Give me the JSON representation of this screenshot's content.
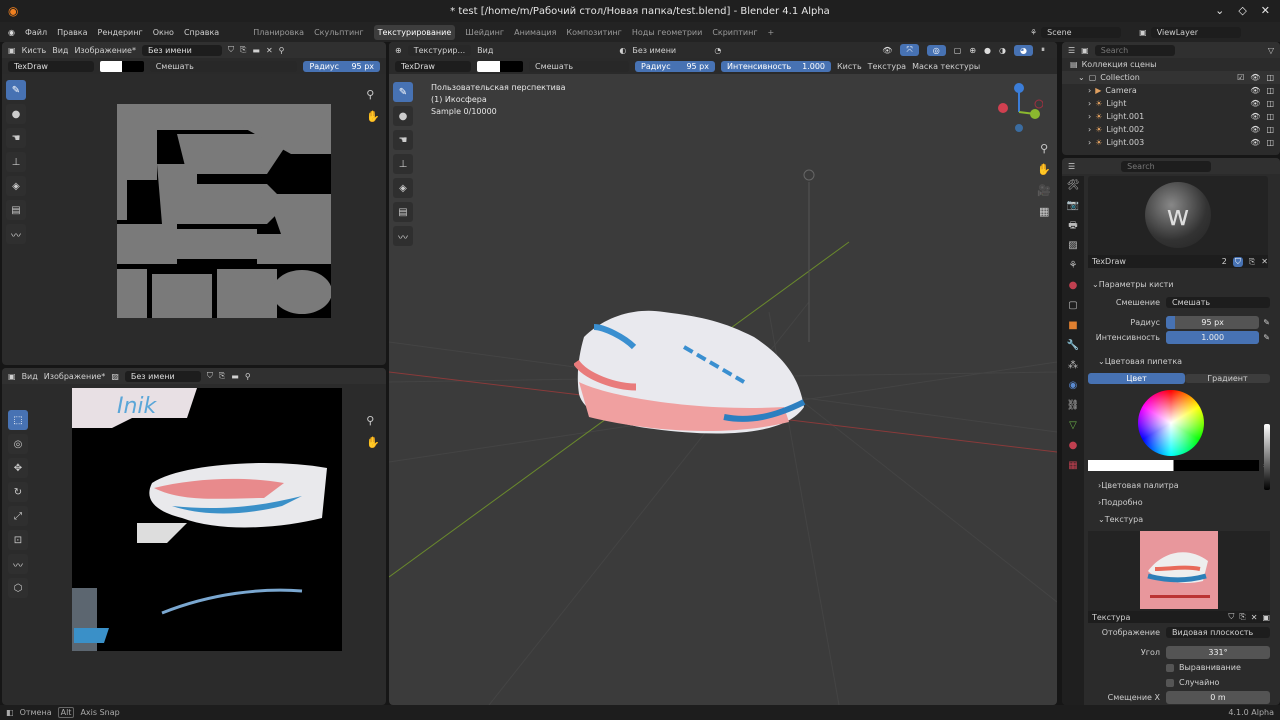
{
  "window": {
    "title": "* test [/home/m/Рабочий стол/Новая папка/test.blend] - Blender 4.1 Alpha"
  },
  "menu": [
    "Файл",
    "Правка",
    "Рендеринг",
    "Окно",
    "Справка"
  ],
  "workspaces": [
    "Планировка",
    "Скульптинг",
    "Текстурирование",
    "Шейдинг",
    "Анимация",
    "Композитинг",
    "Ноды геометрии",
    "Скриптинг"
  ],
  "active_workspace": "Текстурирование",
  "scene": "Scene",
  "view_layer": "ViewLayer",
  "image_editor_top": {
    "mode": "Кисть",
    "view": "Вид",
    "image_menu": "Изображение*",
    "image_name": "Без имени",
    "brush": "TexDraw",
    "blend": "Смешать",
    "radius_label": "Радиус",
    "radius": "95 px"
  },
  "image_editor_bottom": {
    "view": "Вид",
    "image_menu": "Изображение*",
    "image_name": "Без имени"
  },
  "viewport": {
    "mode": "Текстурир...",
    "view": "Вид",
    "image_name": "Без имени",
    "brush": "TexDraw",
    "blend": "Смешать",
    "radius_label": "Радиус",
    "radius": "95 px",
    "strength_label": "Интенсивность",
    "strength": "1.000",
    "brush_menu": "Кисть",
    "texture_menu": "Текстура",
    "mask_menu": "Маска текстуры",
    "overlay_lines": [
      "Пользовательская перспектива",
      "(1) Икосфера",
      "Sample 0/10000"
    ]
  },
  "outliner": {
    "search_placeholder": "Search",
    "root": "Коллекция сцены",
    "items": [
      "Collection",
      "Camera",
      "Light",
      "Light.001",
      "Light.002",
      "Light.003"
    ]
  },
  "properties": {
    "search_placeholder": "Search",
    "brush_name": "TexDraw",
    "users": "2",
    "brush_section": "Параметры кисти",
    "blend_label": "Смешение",
    "blend": "Смешать",
    "radius_label": "Радиус",
    "radius": "95 px",
    "radius_fraction": 0.1,
    "strength_label": "Интенсивность",
    "strength": "1.000",
    "strength_fraction": 1.0,
    "color_picker_section": "Цветовая пипетка",
    "tab_color": "Цвет",
    "tab_gradient": "Градиент",
    "palette_section": "Цветовая палитра",
    "advanced_section": "Подробно",
    "texture_section": "Текстура",
    "texture_name": "Текстура",
    "mapping_label": "Отображение",
    "mapping": "Видовая плоскость",
    "angle_label": "Угол",
    "angle": "331°",
    "align_label": "Выравнивание",
    "random_label": "Случайно",
    "offset_label": "Смещение X",
    "offset": "0 m"
  },
  "status": {
    "cancel": "Отмена",
    "key": "Alt",
    "axis_snap": "Axis Snap",
    "version": "4.1.0 Alpha"
  },
  "colors": {
    "accent": "#4772b3",
    "bg": "#2b2b2b"
  }
}
